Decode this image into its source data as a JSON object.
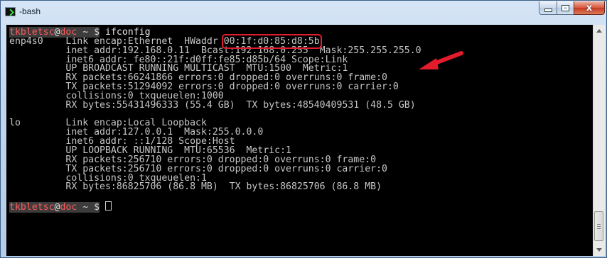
{
  "window": {
    "title": "-bash",
    "close_symbol": "x"
  },
  "terminal": {
    "prompt": {
      "user": "tkbletsc",
      "at": "@",
      "host": "doc",
      "path": " ~ ",
      "dollar": "$",
      "command": " ifconfig"
    },
    "enp4s0": {
      "l1_pre": "enp4s0    Link encap:Ethernet  HWaddr ",
      "hwaddr": "00:1f:d0:85:d8:5b",
      "l2": "          inet addr:192.168.0.11  Bcast:192.168.0.255  Mask:255.255.255.0",
      "l3": "          inet6 addr: fe80::21f:d0ff:fe85:d85b/64 Scope:Link",
      "l4": "          UP BROADCAST RUNNING MULTICAST  MTU:1500  Metric:1",
      "l5": "          RX packets:66241866 errors:0 dropped:0 overruns:0 frame:0",
      "l6": "          TX packets:51294092 errors:0 dropped:0 overruns:0 carrier:0",
      "l7": "          collisions:0 txqueuelen:1000",
      "l8": "          RX bytes:55431496333 (55.4 GB)  TX bytes:48540409531 (48.5 GB)"
    },
    "lo": {
      "l1": "lo        Link encap:Local Loopback",
      "l2": "          inet addr:127.0.0.1  Mask:255.0.0.0",
      "l3": "          inet6 addr: ::1/128 Scope:Host",
      "l4": "          UP LOOPBACK RUNNING  MTU:65536  Metric:1",
      "l5": "          RX packets:256710 errors:0 dropped:0 overruns:0 frame:0",
      "l6": "          TX packets:256710 errors:0 dropped:0 overruns:0 carrier:0",
      "l7": "          collisions:0 txqueuelen:1",
      "l8": "          RX bytes:86825706 (86.8 MB)  TX bytes:86825706 (86.8 MB)"
    }
  },
  "colors": {
    "highlight": "#e21b2d",
    "prompt_red": "#ff5b5b",
    "terminal_bg": "#000000",
    "terminal_fg": "#c6c6c6"
  },
  "icons": {
    "app": "terminal-icon",
    "annotation": "red-arrow-icon"
  }
}
